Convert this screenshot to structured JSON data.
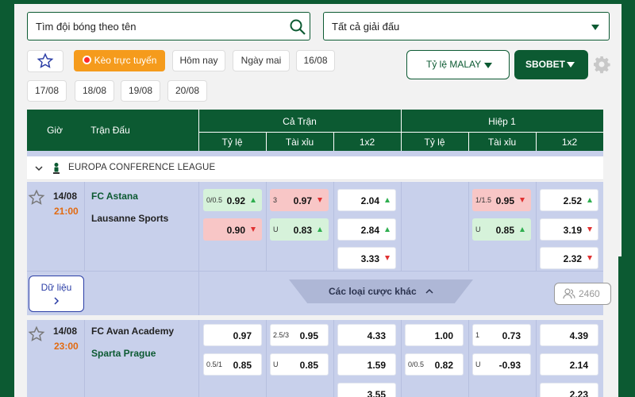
{
  "search": {
    "placeholder": "Tìm đội bóng theo tên",
    "icon": "search-icon"
  },
  "league_select": {
    "value": "Tất cả giải đấu"
  },
  "filters": {
    "live": "Kèo trực tuyến",
    "today": "Hôm nay",
    "tomorrow": "Ngày mai",
    "dates": [
      "16/08",
      "17/08",
      "18/08",
      "19/08",
      "20/08"
    ]
  },
  "odds_type": {
    "label": "Tỷ lệ MALAY"
  },
  "bookmaker": {
    "label": "SBOBET"
  },
  "table_header": {
    "time": "Giờ",
    "match": "Trận Đấu",
    "full_match": "Cả Trận",
    "half1": "Hiệp 1",
    "handicap": "Tỷ lệ",
    "over_under": "Tài xỉu",
    "x12": "1x2"
  },
  "league": {
    "name": "EUROPA CONFERENCE LEAGUE"
  },
  "matches": [
    {
      "date": "14/08",
      "time": "21:00",
      "home": "FC Astana",
      "away": "Lausanne Sports",
      "ft_hdp": {
        "line": "0/0.5",
        "home": "0.92",
        "away": "0.90"
      },
      "ft_ou": {
        "line": "3",
        "over": "0.97",
        "under_label": "U",
        "under": "0.83"
      },
      "ft_1x2": [
        "2.04",
        "2.84",
        "3.33"
      ],
      "h1_ou": {
        "line": "1/1.5",
        "over": "0.95",
        "under_label": "U",
        "under": "0.85"
      },
      "h1_1x2": [
        "2.52",
        "3.19",
        "2.32"
      ]
    },
    {
      "date": "14/08",
      "time": "23:00",
      "home": "FC Avan Academy",
      "away": "Sparta Prague",
      "ft_hdp": {
        "home": "0.97",
        "line2": "0.5/1",
        "away": "0.85"
      },
      "ft_ou": {
        "line": "2.5/3",
        "over": "0.95",
        "under_label": "U",
        "under": "0.85"
      },
      "ft_1x2": [
        "4.33",
        "1.59",
        "3.55"
      ],
      "h1_hdp": {
        "home": "1.00",
        "line2": "0/0.5",
        "away": "0.82"
      },
      "h1_ou": {
        "line": "1",
        "over": "0.73",
        "under_label": "U",
        "under": "-0.93"
      },
      "h1_1x2": [
        "4.39",
        "2.14",
        "2.23"
      ]
    }
  ],
  "more": {
    "data_label": "Dữ liệu",
    "other_bets": "Các loại cược khác",
    "viewers": "2460"
  },
  "colors": {
    "brand": "#0c5a32",
    "live": "#f59b1c",
    "up": "#2fae4f",
    "down": "#e03131",
    "time": "#e26a10"
  }
}
